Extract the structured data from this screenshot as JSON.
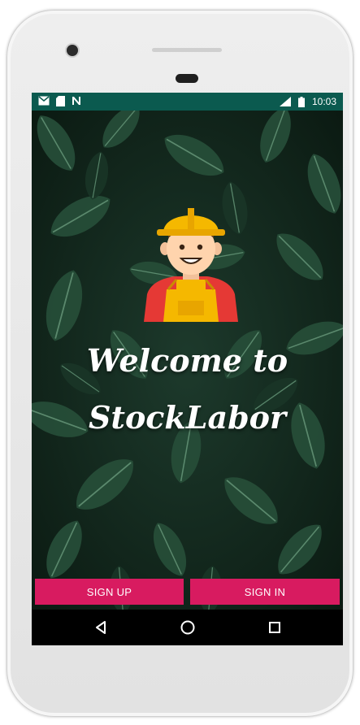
{
  "status_bar": {
    "time": "10:03",
    "left_icons": [
      "gmail-icon",
      "sd-card-icon",
      "n-icon"
    ],
    "right_icons": [
      "signal-icon",
      "battery-icon"
    ]
  },
  "welcome": {
    "line1": "Welcome to",
    "line2": "StockLabor"
  },
  "buttons": {
    "sign_up": "SIGN UP",
    "sign_in": "SIGN IN"
  },
  "nav_bar": {
    "icons": [
      "back-icon",
      "home-icon",
      "recents-icon"
    ]
  },
  "colors": {
    "status_bar": "#0b5a4f",
    "button": "#d81b60",
    "leaf_background": "#13251c"
  }
}
